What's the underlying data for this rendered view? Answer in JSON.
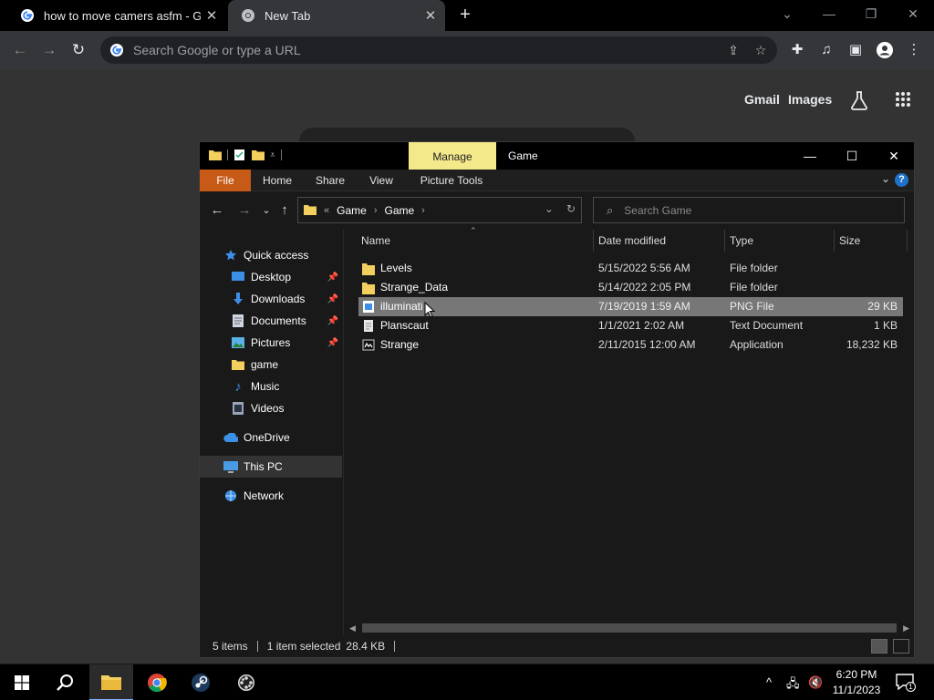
{
  "chrome": {
    "tabs": [
      {
        "title": "how to move camers asfm - Goo",
        "active": false
      },
      {
        "title": "New Tab",
        "active": true
      }
    ],
    "omnibox_placeholder": "Search Google or type a URL",
    "ntp_links": [
      "Gmail",
      "Images"
    ]
  },
  "explorer": {
    "manage_label": "Manage",
    "title": "Game",
    "ribbon_tabs": [
      "File",
      "Home",
      "Share",
      "View",
      "Picture Tools"
    ],
    "breadcrumb_prefix": "«",
    "breadcrumb": [
      "Game",
      "Game"
    ],
    "search_placeholder": "Search Game",
    "nav": [
      {
        "label": "Quick access",
        "icon": "star-icon",
        "pinned": false
      },
      {
        "label": "Desktop",
        "icon": "desktop-icon",
        "pinned": true
      },
      {
        "label": "Downloads",
        "icon": "download-icon",
        "pinned": true
      },
      {
        "label": "Documents",
        "icon": "documents-icon",
        "pinned": true
      },
      {
        "label": "Pictures",
        "icon": "pictures-icon",
        "pinned": true
      },
      {
        "label": "game",
        "icon": "folder-icon",
        "pinned": false
      },
      {
        "label": "Music",
        "icon": "music-icon",
        "pinned": false
      },
      {
        "label": "Videos",
        "icon": "videos-icon",
        "pinned": false
      },
      {
        "label": "OneDrive",
        "icon": "cloud-icon",
        "pinned": false
      },
      {
        "label": "This PC",
        "icon": "pc-icon",
        "pinned": false,
        "selected": true
      },
      {
        "label": "Network",
        "icon": "network-icon",
        "pinned": false
      }
    ],
    "columns": [
      "Name",
      "Date modified",
      "Type",
      "Size"
    ],
    "files": [
      {
        "name": "Levels",
        "date": "5/15/2022 5:56 AM",
        "type": "File folder",
        "size": "",
        "icon": "folder-icon"
      },
      {
        "name": "Strange_Data",
        "date": "5/14/2022 2:05 PM",
        "type": "File folder",
        "size": "",
        "icon": "folder-icon"
      },
      {
        "name": "illuminati",
        "date": "7/19/2019 1:59 AM",
        "type": "PNG File",
        "size": "29 KB",
        "icon": "image-file-icon",
        "selected": true
      },
      {
        "name": "Planscaut",
        "date": "1/1/2021 2:02 AM",
        "type": "Text Document",
        "size": "1 KB",
        "icon": "text-file-icon"
      },
      {
        "name": "Strange",
        "date": "2/11/2015 12:00 AM",
        "type": "Application",
        "size": "18,232 KB",
        "icon": "app-icon"
      }
    ],
    "status": {
      "items": "5 items",
      "selected": "1 item selected",
      "size": "28.4 KB"
    }
  },
  "taskbar": {
    "time": "6:20 PM",
    "date": "11/1/2023",
    "notification_count": "1"
  },
  "colors": {
    "file_tab": "#c75a17",
    "manage_tab": "#f4e98a",
    "folder": "#f3cf5e",
    "selection": "#777777"
  }
}
